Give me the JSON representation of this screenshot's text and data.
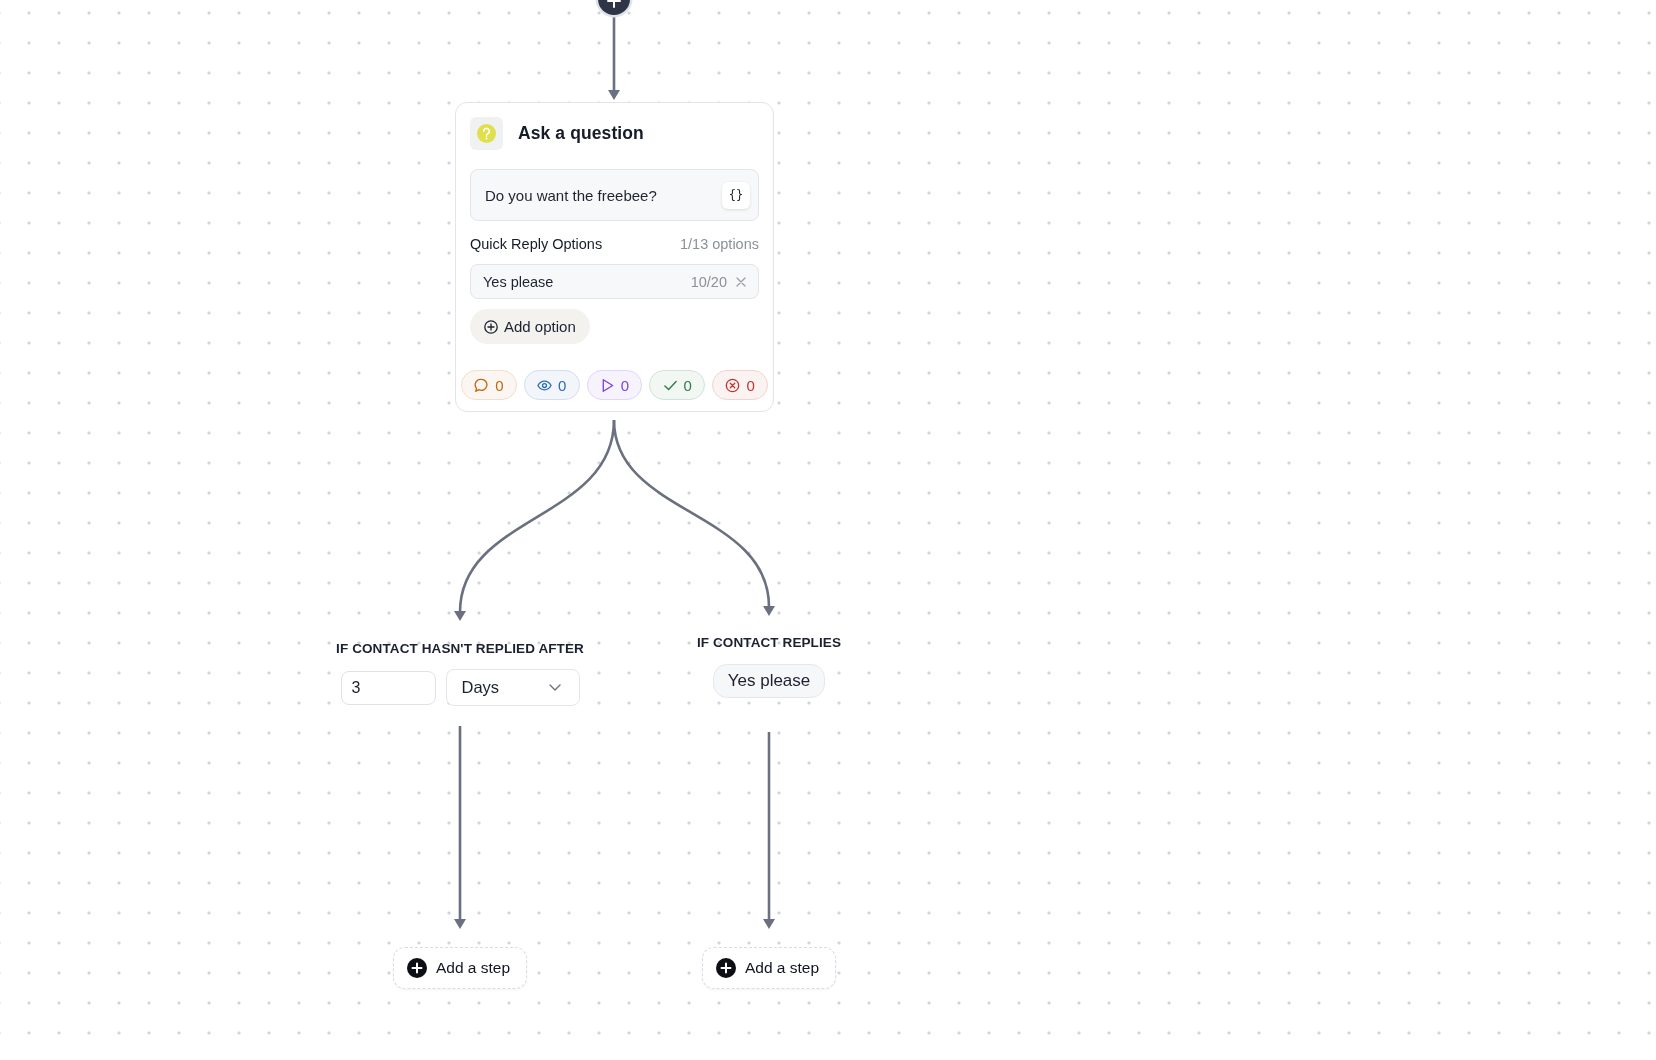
{
  "question_step": {
    "title": "Ask a question",
    "message": "Do you want the freebee?",
    "variable_button": "{}",
    "quick_replies": {
      "label": "Quick Reply Options",
      "count": "1/13 options",
      "options": [
        {
          "text": "Yes please",
          "char_count": "10/20"
        }
      ],
      "add_button": "Add option"
    },
    "stats": [
      {
        "kind": "comment",
        "value": "0",
        "color": "#c2680f"
      },
      {
        "kind": "view",
        "value": "0",
        "color": "#2c6cb0"
      },
      {
        "kind": "play",
        "value": "0",
        "color": "#7b3fe4"
      },
      {
        "kind": "check",
        "value": "0",
        "color": "#2e7d4a"
      },
      {
        "kind": "error",
        "value": "0",
        "color": "#c2362d"
      }
    ]
  },
  "branches": [
    {
      "kind": "timeout",
      "label": "IF CONTACT HASN'T REPLIED AFTER",
      "amount": "3",
      "unit": "Days",
      "add_step": "Add a step"
    },
    {
      "kind": "reply",
      "label": "IF CONTACT REPLIES",
      "reply": "Yes please",
      "add_step": "Add a step"
    }
  ]
}
